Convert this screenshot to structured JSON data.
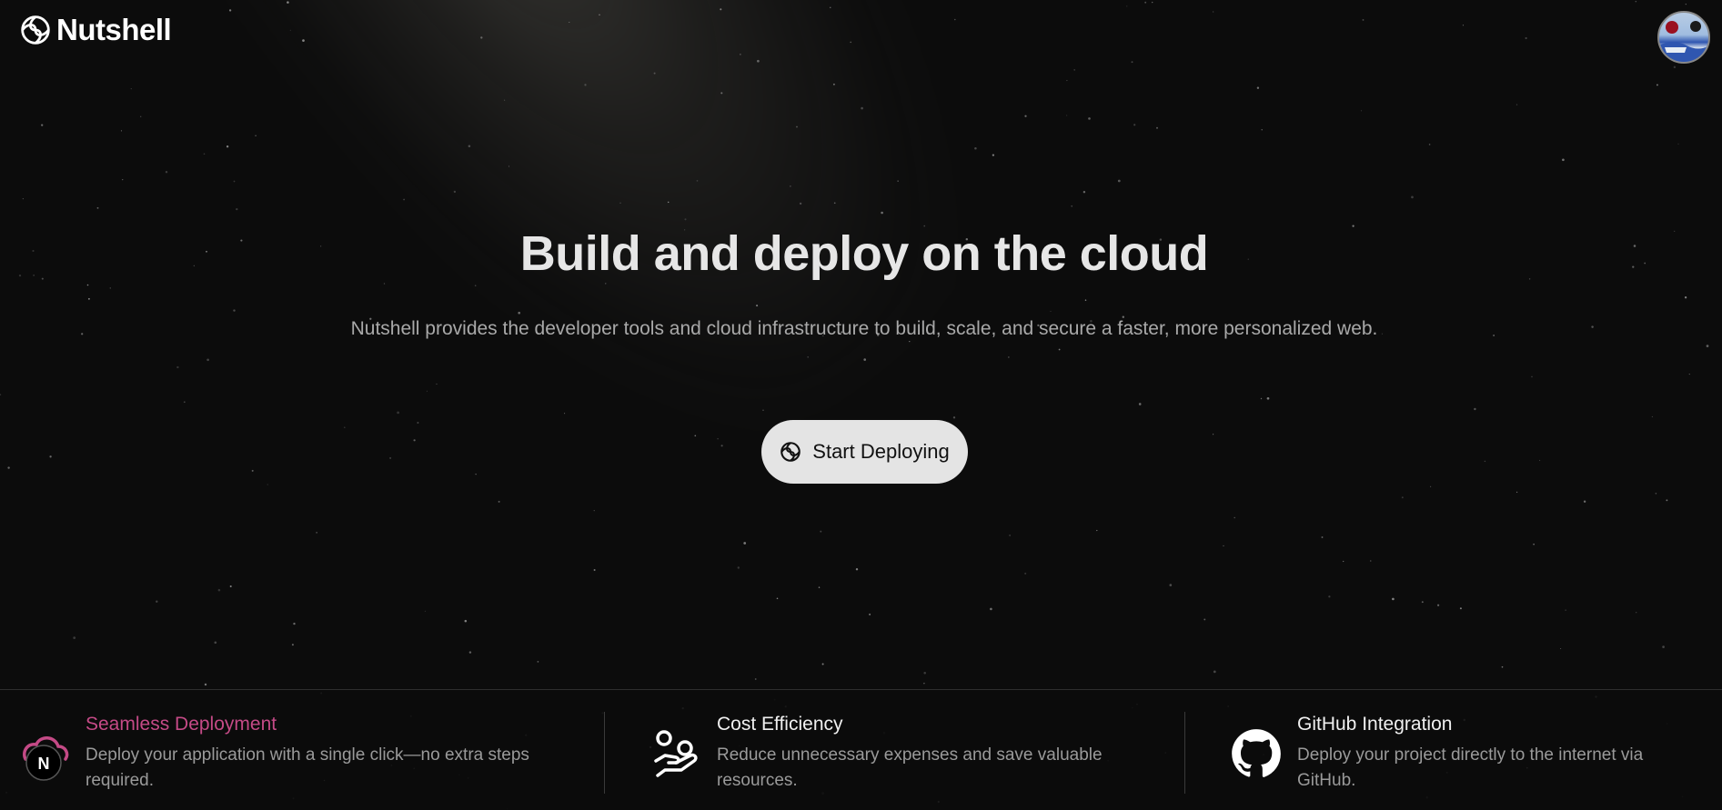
{
  "header": {
    "brand": "Nutshell",
    "logo_icon": "nutshell-swirl-icon",
    "avatar_icon": "user-avatar"
  },
  "hero": {
    "title": "Build and deploy on the cloud",
    "subtitle": "Nutshell provides the developer tools and cloud infrastructure to build, scale, and secure a faster, more personalized web.",
    "cta_label": "Start Deploying",
    "cta_icon": "nutshell-swirl-icon"
  },
  "features": [
    {
      "title": "Seamless Deployment",
      "description": "Deploy your application with a single click—no extra steps required.",
      "icon": "cloud-nextjs-icon",
      "title_color": "#c44a86"
    },
    {
      "title": "Cost Efficiency",
      "description": "Reduce unnecessary expenses and save valuable resources.",
      "icon": "hand-coins-icon"
    },
    {
      "title": "GitHub Integration",
      "description": "Deploy your project directly to the internet via GitHub.",
      "icon": "github-icon"
    }
  ],
  "colors": {
    "background": "#0c0c0c",
    "accent_pink": "#c44a86",
    "button_bg": "#e4e4e4"
  }
}
